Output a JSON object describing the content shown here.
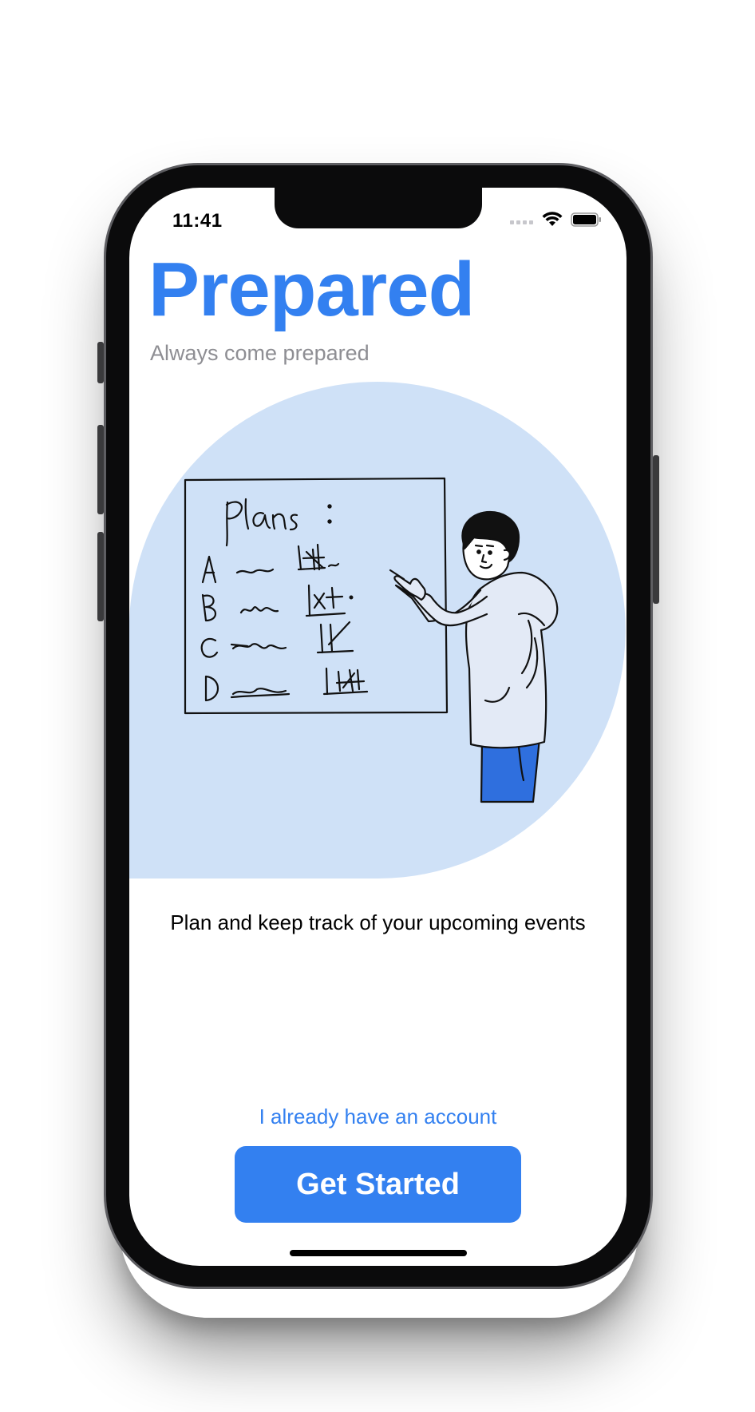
{
  "status_bar": {
    "time": "11:41",
    "icons": [
      "cellular-signal-icon",
      "wifi-icon",
      "battery-icon"
    ]
  },
  "app": {
    "title": "Prepared",
    "subtitle": "Always come prepared",
    "tagline": "Plan and keep track of your upcoming events",
    "login_link": "I already have an account",
    "cta_label": "Get Started"
  },
  "illustration": {
    "board_heading": "Plans :",
    "board_rows": [
      "A",
      "B",
      "C",
      "D"
    ],
    "subject": "person-pointing-at-whiteboard"
  },
  "colors": {
    "accent": "#3380f0",
    "illustration_bg": "#cfe1f7",
    "pants": "#2f6fde",
    "subtitle": "#8e8e93"
  }
}
